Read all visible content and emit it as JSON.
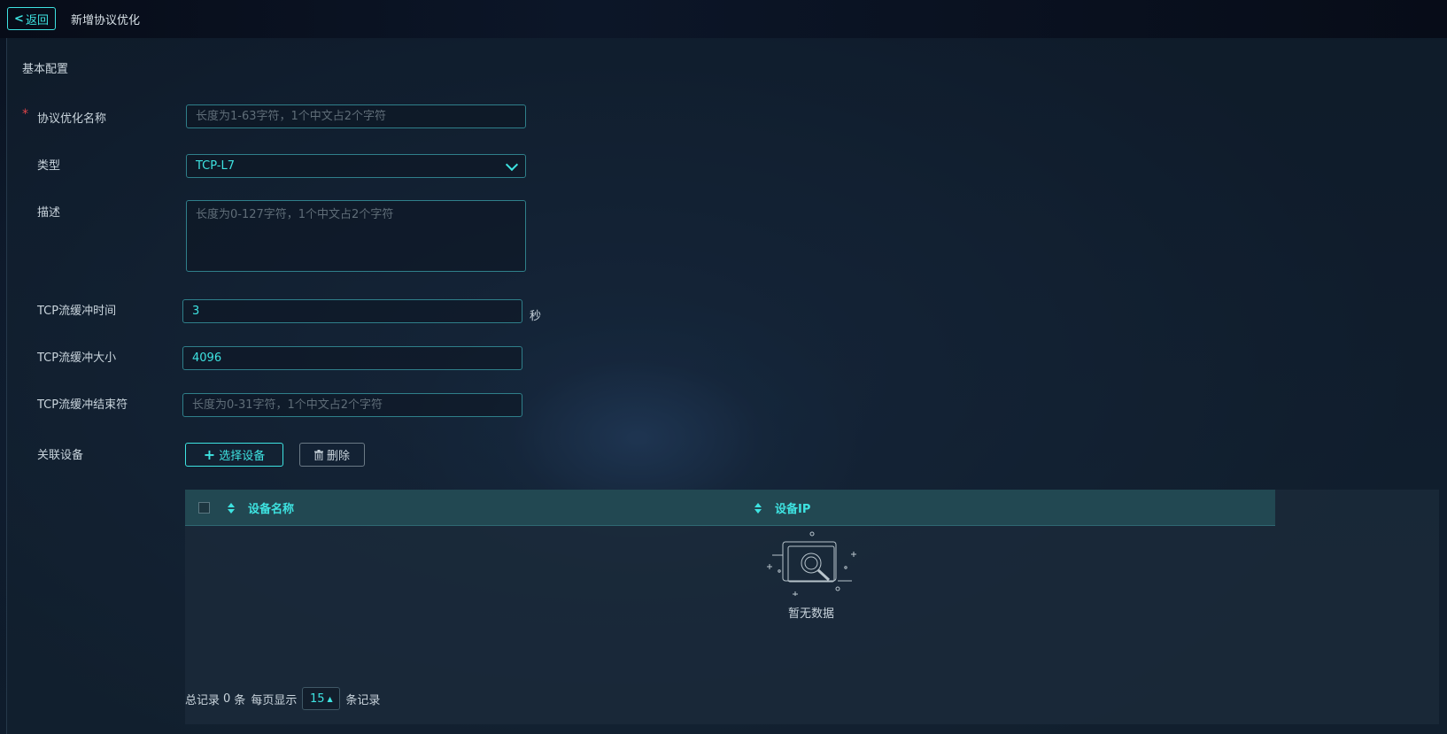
{
  "header": {
    "back_label": "返回",
    "page_title": "新增协议优化"
  },
  "section": {
    "title": "基本配置"
  },
  "form": {
    "name": {
      "label": "协议优化名称",
      "placeholder": "长度为1-63字符，1个中文占2个字符",
      "required_mark": "*"
    },
    "type": {
      "label": "类型",
      "value": "TCP-L7"
    },
    "description": {
      "label": "描述",
      "placeholder": "长度为0-127字符，1个中文占2个字符"
    },
    "buffer_time": {
      "label": "TCP流缓冲时间",
      "value": "3",
      "unit": "秒"
    },
    "buffer_size": {
      "label": "TCP流缓冲大小",
      "value": "4096"
    },
    "buffer_terminator": {
      "label": "TCP流缓冲结束符",
      "placeholder": "长度为0-31字符，1个中文占2个字符"
    },
    "devices": {
      "label": "关联设备",
      "select_button": "选择设备",
      "delete_button": "删除"
    }
  },
  "table": {
    "columns": [
      "设备名称",
      "设备IP"
    ],
    "rows": [],
    "empty_text": "暂无数据"
  },
  "pagination": {
    "total_prefix": "总记录",
    "total_count": "0",
    "total_suffix": "条",
    "per_page_label": "每页显示",
    "per_page_value": "15",
    "per_page_suffix": "条记录"
  },
  "colors": {
    "accent": "#3ee3e1",
    "required": "#e0454a",
    "table_header": "#224852"
  }
}
